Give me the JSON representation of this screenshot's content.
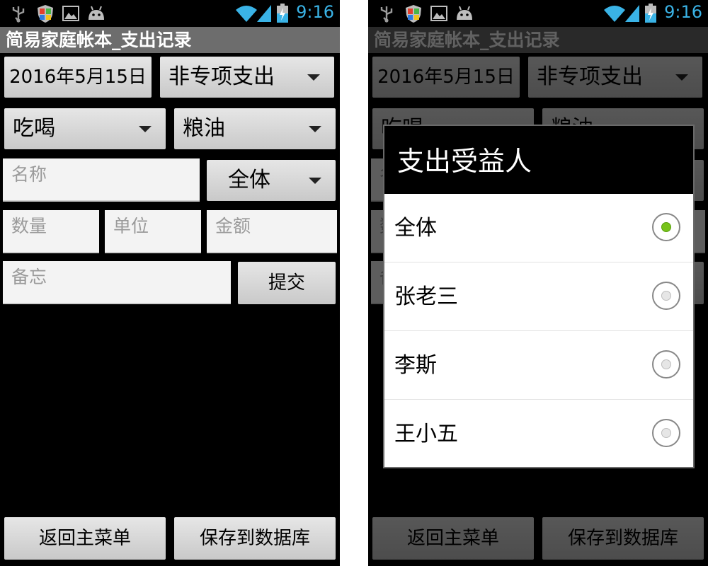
{
  "status": {
    "time": "9:16",
    "clock_color": "#3ab3e6"
  },
  "app": {
    "title": "简易家庭帐本_支出记录"
  },
  "form": {
    "date": "2016年5月15日",
    "type_spinner": "非专项支出",
    "category_spinner": "吃喝",
    "subcategory_spinner": "粮油",
    "beneficiary_spinner": "全体",
    "name_placeholder": "名称",
    "qty_placeholder": "数量",
    "unit_placeholder": "单位",
    "amount_placeholder": "金额",
    "memo_placeholder": "备忘",
    "submit": "提交",
    "back": "返回主菜单",
    "save": "保存到数据库"
  },
  "dialog": {
    "title": "支出受益人",
    "options": [
      {
        "label": "全体",
        "selected": true
      },
      {
        "label": "张老三",
        "selected": false
      },
      {
        "label": "李斯",
        "selected": false
      },
      {
        "label": "王小五",
        "selected": false
      }
    ],
    "selected_color": "#77c31a"
  }
}
